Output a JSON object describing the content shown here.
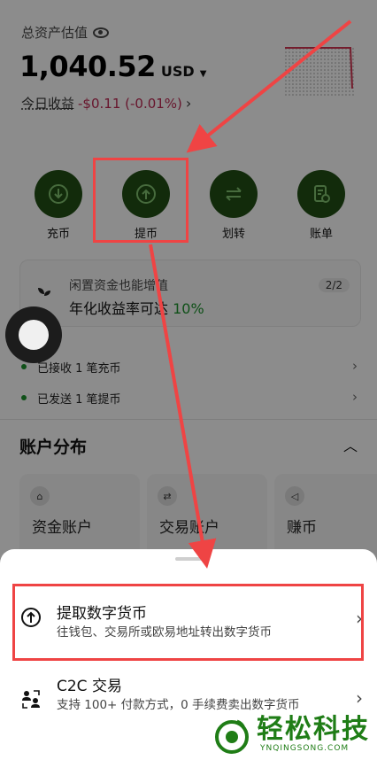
{
  "header": {
    "total_label": "总资产估值",
    "balance": "1,040.52",
    "currency": "USD",
    "today_label": "今日收益",
    "today_value": "-$0.11 (-0.01%)"
  },
  "actions": [
    {
      "label": "充币",
      "icon": "deposit-icon"
    },
    {
      "label": "提币",
      "icon": "withdraw-icon"
    },
    {
      "label": "划转",
      "icon": "transfer-icon"
    },
    {
      "label": "账单",
      "icon": "bill-icon"
    }
  ],
  "promo": {
    "title": "闲置资金也能增值",
    "subtitle_prefix": "年化收益率可达",
    "subtitle_value": "10%",
    "page": "2/2"
  },
  "notices": [
    {
      "text": "已接收 1 笔充币"
    },
    {
      "text": "已发送 1 笔提币"
    }
  ],
  "distribution": {
    "title": "账户分布",
    "accounts": [
      {
        "label": "资金账户"
      },
      {
        "label": "交易账户"
      },
      {
        "label": "赚币"
      }
    ]
  },
  "sheet": {
    "options": [
      {
        "title": "提取数字货币",
        "desc": "往钱包、交易所或欧易地址转出数字货币",
        "icon": "upload-circle-icon"
      },
      {
        "title": "C2C 交易",
        "desc": "支持 100+ 付款方式，0 手续费卖出数字货币",
        "icon": "people-exchange-icon"
      }
    ]
  },
  "watermark": {
    "name": "轻松科技",
    "url": "YNQINGSONG.COM"
  },
  "colors": {
    "accent_green": "#1f4a14",
    "loss_red": "#b3274f",
    "highlight_red": "#ef4444"
  }
}
